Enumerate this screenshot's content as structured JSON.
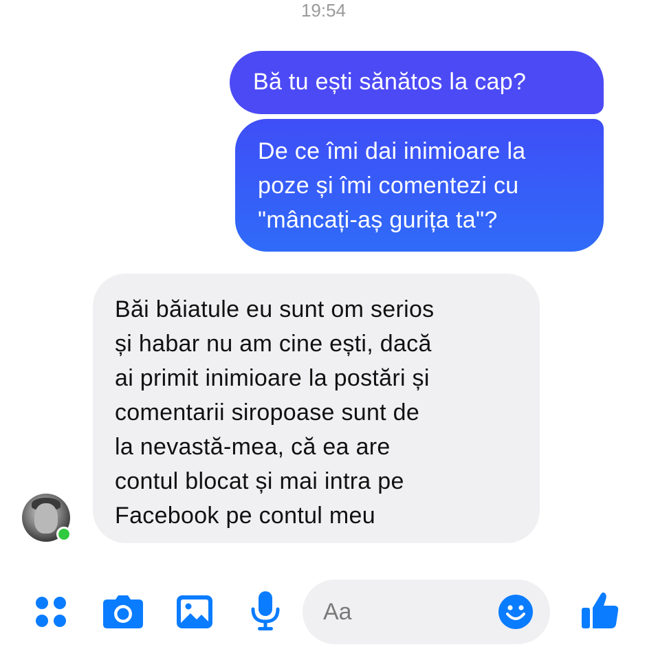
{
  "status": {
    "time": "19:54"
  },
  "messages": [
    {
      "direction": "outgoing",
      "text": "Bă tu ești sănătos la cap?"
    },
    {
      "direction": "outgoing",
      "text": "De ce îmi dai inimioare la\npoze și îmi comentezi cu\n\"mâncați-aș gurița ta\"?"
    },
    {
      "direction": "incoming",
      "text": "Băi băiatule eu sunt om serios\nși habar nu am cine ești, dacă\nai primit inimioare la postări și\ncomentarii siropoase sunt de\nla nevastă-mea, că ea are\ncontul blocat și mai intra pe\nFacebook pe contul meu"
    }
  ],
  "contact": {
    "online": true
  },
  "composer": {
    "placeholder": "Aa"
  },
  "toolbar": {
    "icons": [
      "more-actions-icon",
      "camera-icon",
      "gallery-icon",
      "microphone-icon",
      "emoji-icon",
      "thumbs-up-icon"
    ]
  },
  "colors": {
    "accent": "#0a7cff",
    "outgoing_bubble": "#4c4af5",
    "incoming_bubble": "#f0f0f2",
    "online": "#31c93f"
  }
}
